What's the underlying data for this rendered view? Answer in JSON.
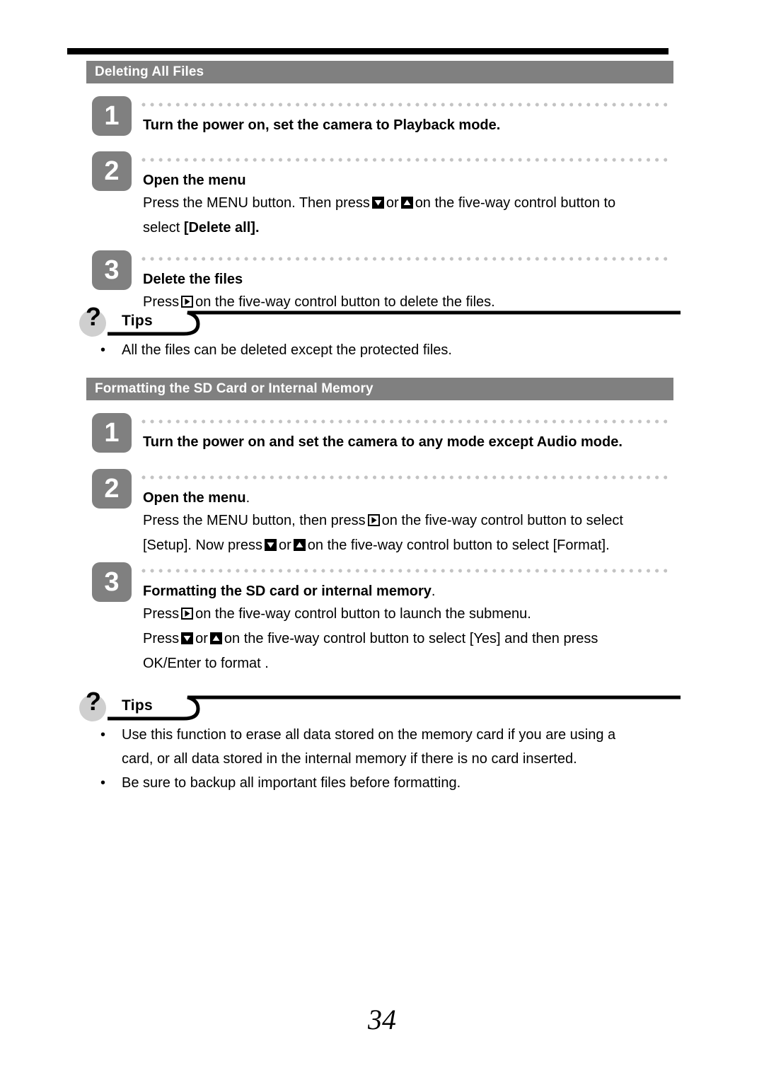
{
  "page": {
    "number": "34"
  },
  "sections": [
    {
      "title": "Deleting All Files",
      "steps": [
        {
          "number": "1",
          "title": "Turn the power on, set the camera to Playback mode.",
          "lines": []
        },
        {
          "number": "2",
          "title": "Open the menu",
          "lines": [
            "Press the MENU button. Then press  ▼  or  ▲  on the five-way control button to",
            "select [Delete all]."
          ]
        },
        {
          "number": "3",
          "title": "Delete the files",
          "lines": [
            "Press  ▶  on the five-way control button to delete the files."
          ]
        }
      ],
      "tips": {
        "label": "Tips",
        "items": [
          "All the files can be deleted except the protected files."
        ]
      }
    },
    {
      "title": "Formatting the SD Card or Internal Memory",
      "steps": [
        {
          "number": "1",
          "title": "Turn the power on and set the camera to any mode except Audio mode.",
          "lines": []
        },
        {
          "number": "2",
          "title": "Open the menu.",
          "lines": [
            "Press the MENU button, then press  ▶  on the five-way control button to select",
            "[Setup]. Now press  ▼  or  ▲  on the five-way control button to select [Format]."
          ]
        },
        {
          "number": "3",
          "title": "Formatting the SD card or internal memory.",
          "lines": [
            "Press  ▶  on the five-way control button to launch the submenu.",
            "Press  ▼  or  ▲  on the five-way control button to select [Yes] and then press",
            "OK/Enter to format ."
          ]
        }
      ],
      "tips": {
        "label": "Tips",
        "items": [
          "Use this function to erase all data stored on the memory card if you are using a card, or all data stored in the internal memory if there is no card inserted.",
          "Be sure to backup all important files before formatting."
        ]
      }
    }
  ],
  "text_fragments": {
    "s1_step1_title": "Turn the power on, set the camera to Playback mode.",
    "s1_step2_title": "Open the menu",
    "s1_step2_l1_a": "Press the MENU button. Then press",
    "s1_step2_l1_b": "or",
    "s1_step2_l1_c": "on the five-way control button to",
    "s1_step2_l2_a": "select",
    "s1_step2_l2_b": "[Delete all].",
    "s1_step3_title": "Delete the files",
    "s1_step3_l1_a": "Press",
    "s1_step3_l1_b": "on the five-way control button to delete the files.",
    "s1_tip1": "All the files can be deleted except the protected files.",
    "s2_step1_title": "Turn the power on and set the camera to any mode except Audio mode.",
    "s2_step2_title_a": "Open the menu",
    "s2_step2_title_b": ".",
    "s2_step2_l1_a": "Press the MENU button, then press",
    "s2_step2_l1_b": "on the five-way control button to select",
    "s2_step2_l2_a": "[Setup]. Now press",
    "s2_step2_l2_b": "or",
    "s2_step2_l2_c": "on the five-way control button to select [Format].",
    "s2_step3_title_a": "Formatting the SD card or internal memory",
    "s2_step3_title_b": ".",
    "s2_step3_l1_a": "Press",
    "s2_step3_l1_b": "on the five-way control button to launch the submenu.",
    "s2_step3_l2_a": "Press",
    "s2_step3_l2_b": "or",
    "s2_step3_l2_c": "on the five-way control button to select [Yes] and then press",
    "s2_step3_l3": "OK/Enter to format .",
    "s2_tip1_line1": "Use this function to erase all data stored on the memory card if you are using a",
    "s2_tip1_line2": "card, or all data stored in the internal memory if there is no card inserted.",
    "s2_tip2": "Be sure to backup all important files before formatting.",
    "bullet": "•"
  },
  "colors": {
    "section_bar": "#808080",
    "step_badge": "#808080",
    "dots": "#c3c3c3",
    "tips_bubble": "#cfcfcf",
    "rule": "#000000"
  }
}
